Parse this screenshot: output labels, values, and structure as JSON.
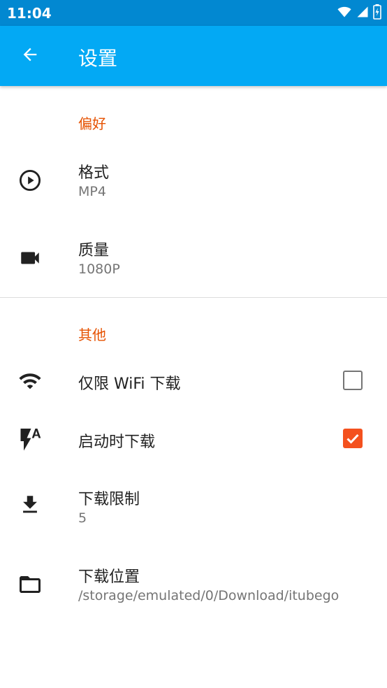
{
  "status_bar": {
    "time": "11:04",
    "icons": [
      "wifi-icon",
      "signal-icon",
      "battery-icon"
    ]
  },
  "toolbar": {
    "title": "设置",
    "back_icon": "arrow-back-icon",
    "background": "#03a9f4"
  },
  "sections": {
    "preferences": {
      "header": "偏好",
      "format": {
        "title": "格式",
        "value": "MP4",
        "icon": "play-circle-icon"
      },
      "quality": {
        "title": "质量",
        "value": "1080P",
        "icon": "videocam-icon"
      }
    },
    "other": {
      "header": "其他",
      "wifi_only": {
        "title": "仅限 WiFi 下载",
        "checked": false,
        "icon": "wifi-icon"
      },
      "download_on_start": {
        "title": "启动时下载",
        "checked": true,
        "icon": "flash-auto-icon"
      },
      "download_limit": {
        "title": "下载限制",
        "value": "5",
        "icon": "download-icon"
      },
      "download_location": {
        "title": "下载位置",
        "value": "/storage/emulated/0/Download/itubego",
        "icon": "folder-icon"
      }
    }
  },
  "colors": {
    "accent": "#e65100",
    "checkbox_checked": "#f4511e",
    "status_bar": "#0288d1"
  }
}
